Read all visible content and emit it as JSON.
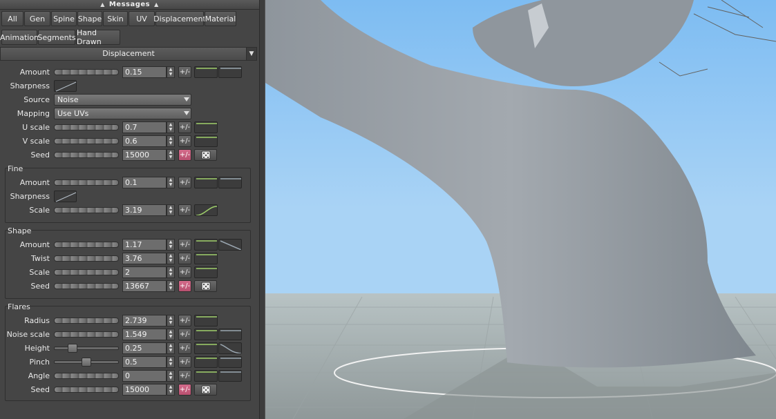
{
  "messages_bar": {
    "title": "Messages"
  },
  "tabs_row1": [
    "All",
    "Gen",
    "Spine",
    "Shape",
    "Skin",
    "UV",
    "Displacement",
    "Material"
  ],
  "tabs_row2": [
    "Animation",
    "Segments",
    "Hand Drawn"
  ],
  "section": {
    "title": "Displacement"
  },
  "displacement": {
    "amount": {
      "label": "Amount",
      "value": "0.15"
    },
    "sharpness": {
      "label": "Sharpness"
    },
    "source": {
      "label": "Source",
      "value": "Noise"
    },
    "mapping": {
      "label": "Mapping",
      "value": "Use UVs"
    },
    "u_scale": {
      "label": "U scale",
      "value": "0.7"
    },
    "v_scale": {
      "label": "V scale",
      "value": "0.6"
    },
    "seed": {
      "label": "Seed",
      "value": "15000"
    }
  },
  "fine": {
    "title": "Fine",
    "amount": {
      "label": "Amount",
      "value": "0.1"
    },
    "sharpness": {
      "label": "Sharpness"
    },
    "scale": {
      "label": "Scale",
      "value": "3.19"
    }
  },
  "shape": {
    "title": "Shape",
    "amount": {
      "label": "Amount",
      "value": "1.17"
    },
    "twist": {
      "label": "Twist",
      "value": "3.76"
    },
    "scale": {
      "label": "Scale",
      "value": "2"
    },
    "seed": {
      "label": "Seed",
      "value": "13667"
    }
  },
  "flares": {
    "title": "Flares",
    "radius": {
      "label": "Radius",
      "value": "2.739"
    },
    "noise_scale": {
      "label": "Noise scale",
      "value": "1.549"
    },
    "height": {
      "label": "Height",
      "value": "0.25"
    },
    "pinch": {
      "label": "Pinch",
      "value": "0.5"
    },
    "angle": {
      "label": "Angle",
      "value": "0"
    },
    "seed": {
      "label": "Seed",
      "value": "15000"
    }
  },
  "common": {
    "pm": "+/-"
  },
  "colors": {
    "curve_green": "#9ecf6a",
    "active_pink": "#c45c7c",
    "sky": "#8ec7f5",
    "ground": "#a9b2b3",
    "trunk": "#8f969d"
  }
}
